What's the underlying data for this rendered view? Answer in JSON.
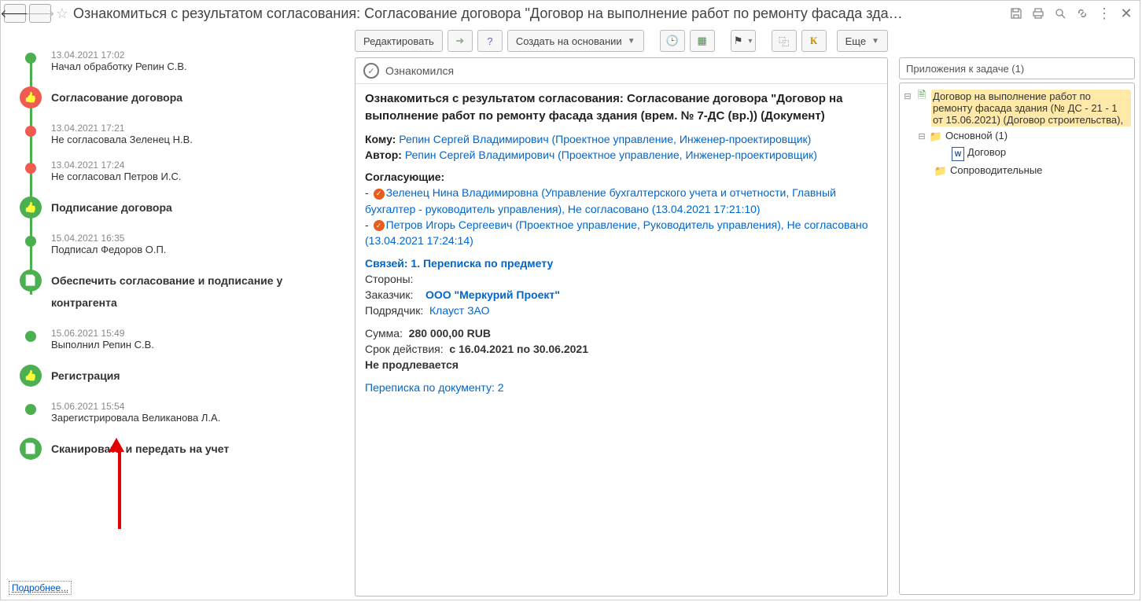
{
  "header": {
    "title": "Ознакомиться с результатом согласования: Согласование договора \"Договор  на  выполнение работ по ремонту фасада зда…"
  },
  "timeline": [
    {
      "kind": "event",
      "marker": "small-green",
      "ts": "13.04.2021 17:02",
      "label": "Начал обработку Репин С.В."
    },
    {
      "kind": "stage",
      "marker": "big-red-thumb",
      "stage": "Согласование договора"
    },
    {
      "kind": "event",
      "marker": "small-red",
      "ts": "13.04.2021 17:21",
      "label": "Не согласовала Зеленец Н.В."
    },
    {
      "kind": "event",
      "marker": "small-red",
      "ts": "13.04.2021 17:24",
      "label": "Не согласовал Петров И.С."
    },
    {
      "kind": "stage",
      "marker": "big-green-thumb",
      "stage": "Подписание договора"
    },
    {
      "kind": "event",
      "marker": "small-green",
      "ts": "15.04.2021 16:35",
      "label": "Подписал Федоров О.П."
    },
    {
      "kind": "stage",
      "marker": "big-green-doc",
      "stage": "Обеспечить согласование и подписание у контрагента"
    },
    {
      "kind": "event",
      "marker": "small-green",
      "ts": "15.06.2021 15:49",
      "label": "Выполнил Репин С.В."
    },
    {
      "kind": "stage",
      "marker": "big-green-thumb",
      "stage": "Регистрация"
    },
    {
      "kind": "event",
      "marker": "small-green",
      "ts": "15.06.2021 15:54",
      "label": "Зарегистрировала Великанова Л.А."
    },
    {
      "kind": "stage",
      "marker": "big-green-doc",
      "stage": "Сканировать и передать на учет"
    }
  ],
  "more_link": "Подробнее...",
  "toolbar": {
    "edit": "Редактировать",
    "create_based": "Создать на основании",
    "more": "Еще"
  },
  "doc": {
    "status": "Ознакомился",
    "title": "Ознакомиться с результатом согласования: Согласование договора \"Договор  на  выполнение работ по ремонту фасада здания (врем. № 7-ДС (вр.)) (Документ)",
    "to_label": "Кому:",
    "to": "Репин Сергей Владимирович (Проектное управление, Инженер-проектировщик)",
    "author_label": "Автор:",
    "author": "Репин Сергей Владимирович (Проектное управление, Инженер-проектировщик)",
    "approvers_label": "Согласующие:",
    "approver1": "Зеленец Нина Владимировна (Управление бухгалтерского учета и отчетности, Главный бухгалтер - руководитель управления), Не согласовано (13.04.2021 17:21:10)",
    "approver2": "Петров Игорь Сергеевич (Проектное управление, Руководитель управления), Не согласовано (13.04.2021 17:24:14)",
    "links_label": "Связей: 1. Переписка по предмету",
    "sides_label": "Стороны:",
    "customer_label": "Заказчик:",
    "customer": "ООО \"Меркурий Проект\"",
    "contractor_label": "Подрядчик:",
    "contractor": "Клауст ЗАО",
    "sum_label": "Сумма:",
    "sum": "280 000,00 RUB",
    "period_label": "Срок действия:",
    "period": "с 16.04.2021 по 30.06.2021",
    "no_prolong": "Не продлевается",
    "correspondence_label": "Переписка по документу:",
    "correspondence_count": "2"
  },
  "attachments": {
    "header": "Приложения к задаче (1)",
    "root": "Договор  на  выполнение работ по ремонту фасада здания (№ ДС - 21 - 1 от 15.06.2021) (Договор строительства),",
    "folder_main": "Основной (1)",
    "file_contract": "Договор",
    "folder_extra": "Сопроводительные"
  }
}
